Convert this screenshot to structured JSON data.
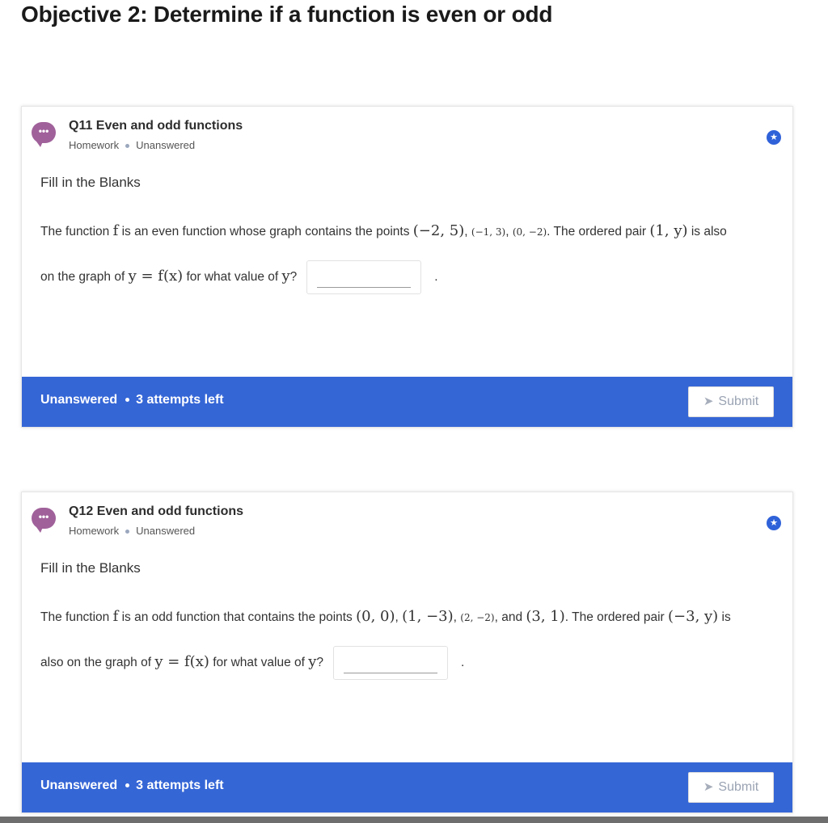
{
  "page": {
    "title": "Objective 2: Determine if a function is even or odd"
  },
  "questions": [
    {
      "title": "Q11 Even and odd functions",
      "meta": {
        "type": "Homework",
        "status": "Unanswered"
      },
      "question_type": "Fill in the Blanks",
      "line1": {
        "pre": "The function ",
        "func": "f",
        "mid": " is an even function whose graph contains the points ",
        "p1": "(−2, 5)",
        "sep1": ", ",
        "p2": "(−1, 3)",
        "sep2": ", ",
        "p3": "(0, −2)",
        "mid2": ". The ordered pair ",
        "pair": "(1, y)",
        "post": " is also"
      },
      "line2": {
        "pre": "on the graph of ",
        "eq": "y = f(x)",
        "mid": " for what value of ",
        "var": "y",
        "post": "?",
        "after": "."
      },
      "footer": {
        "status": "Unanswered",
        "attempts": "3 attempts left",
        "submit": "Submit"
      }
    },
    {
      "title": "Q12 Even and odd functions",
      "meta": {
        "type": "Homework",
        "status": "Unanswered"
      },
      "question_type": "Fill in the Blanks",
      "line1": {
        "pre": "The function ",
        "func": "f",
        "mid": " is an odd function that contains the points ",
        "p1": "(0, 0)",
        "sep1": ", ",
        "p2": "(1, −3)",
        "sep2": ", ",
        "p3": "(2, −2)",
        "mid2": ", and ",
        "p4": "(3, 1)",
        "mid3": ". The ordered pair ",
        "pair": "(−3, y)",
        "post": " is"
      },
      "line2": {
        "pre": "also on the graph of ",
        "eq": "y = f(x)",
        "mid": " for what value of ",
        "var": "y",
        "post": "?",
        "after": "."
      },
      "footer": {
        "status": "Unanswered",
        "attempts": "3 attempts left",
        "submit": "Submit"
      }
    }
  ],
  "icons": {
    "chat": "chat-bubble-icon",
    "star": "star-icon",
    "send": "send-icon"
  },
  "colors": {
    "accent": "#3566d6",
    "chat_icon": "#a0619a",
    "star": "#2f62d9"
  }
}
